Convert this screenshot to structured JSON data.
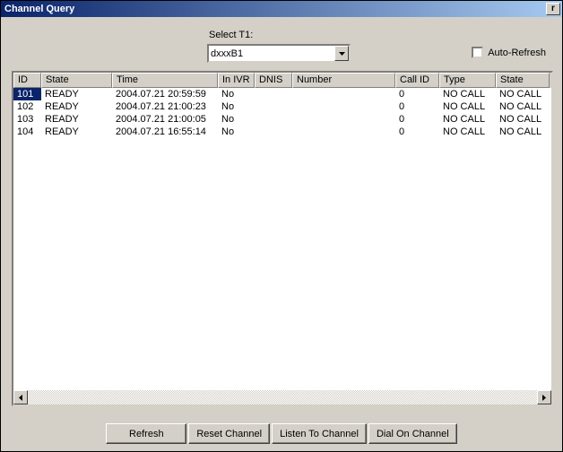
{
  "window": {
    "title": "Channel Query",
    "close_glyph": "r"
  },
  "controls": {
    "select_label": "Select T1:",
    "select_value": "dxxxB1",
    "auto_refresh_label": "Auto-Refresh"
  },
  "table": {
    "columns": [
      "ID",
      "State",
      "Time",
      "In IVR",
      "DNIS",
      "Number",
      "Call ID",
      "Type",
      "State"
    ],
    "rows": [
      {
        "id": "101",
        "state": "READY",
        "time": "2004.07.21 20:59:59",
        "in_ivr": "No",
        "dnis": "",
        "number": "",
        "call_id": "0",
        "type": "NO CALL",
        "state2": "NO CALL",
        "selected": true
      },
      {
        "id": "102",
        "state": "READY",
        "time": "2004.07.21 21:00:23",
        "in_ivr": "No",
        "dnis": "",
        "number": "",
        "call_id": "0",
        "type": "NO CALL",
        "state2": "NO CALL",
        "selected": false
      },
      {
        "id": "103",
        "state": "READY",
        "time": "2004.07.21 21:00:05",
        "in_ivr": "No",
        "dnis": "",
        "number": "",
        "call_id": "0",
        "type": "NO CALL",
        "state2": "NO CALL",
        "selected": false
      },
      {
        "id": "104",
        "state": "READY",
        "time": "2004.07.21 16:55:14",
        "in_ivr": "No",
        "dnis": "",
        "number": "",
        "call_id": "0",
        "type": "NO CALL",
        "state2": "NO CALL",
        "selected": false
      }
    ]
  },
  "buttons": {
    "refresh": "Refresh",
    "reset": "Reset Channel",
    "listen": "Listen To Channel",
    "dial": "Dial On Channel"
  }
}
